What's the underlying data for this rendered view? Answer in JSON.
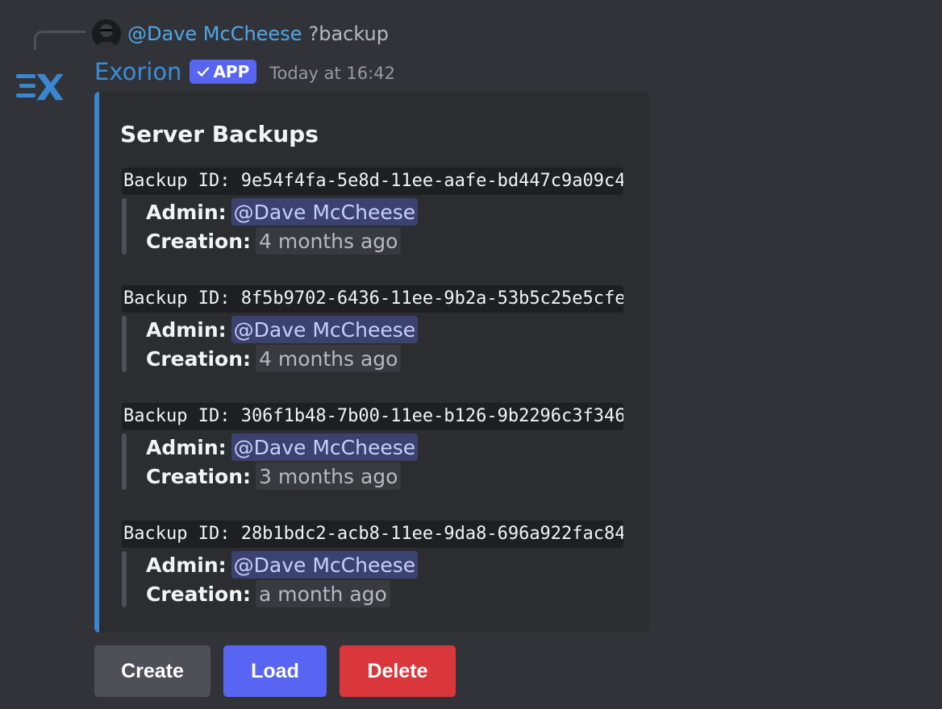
{
  "reply": {
    "mention": "@Dave McCheese",
    "command": "?backup"
  },
  "message": {
    "bot_name": "Exorion",
    "badge": "APP",
    "timestamp": "Today at 16:42"
  },
  "embed": {
    "title": "Server Backups",
    "accent_color": "#3a86d0",
    "admin_label": "Admin:",
    "creation_label": "Creation:",
    "backups": [
      {
        "id_line": "Backup ID: 9e54f4fa-5e8d-11ee-aafe-bd447c9a09c4",
        "admin": "@Dave McCheese",
        "creation": "4 months ago"
      },
      {
        "id_line": "Backup ID: 8f5b9702-6436-11ee-9b2a-53b5c25e5cfe",
        "admin": "@Dave McCheese",
        "creation": "4 months ago"
      },
      {
        "id_line": "Backup ID: 306f1b48-7b00-11ee-b126-9b2296c3f346",
        "admin": "@Dave McCheese",
        "creation": "3 months ago"
      },
      {
        "id_line": "Backup ID: 28b1bdc2-acb8-11ee-9da8-696a922fac84",
        "admin": "@Dave McCheese",
        "creation": "a month ago"
      }
    ]
  },
  "buttons": {
    "create": "Create",
    "load": "Load",
    "delete": "Delete"
  },
  "colors": {
    "background": "#313338",
    "embed_bg": "#2b2d31",
    "mention_text": "#4ea8ec",
    "bot_name": "#3a8fd8",
    "app_badge": "#5865f2",
    "create_button": "#4e5058",
    "load_button": "#5865f2",
    "delete_button": "#da373c"
  }
}
